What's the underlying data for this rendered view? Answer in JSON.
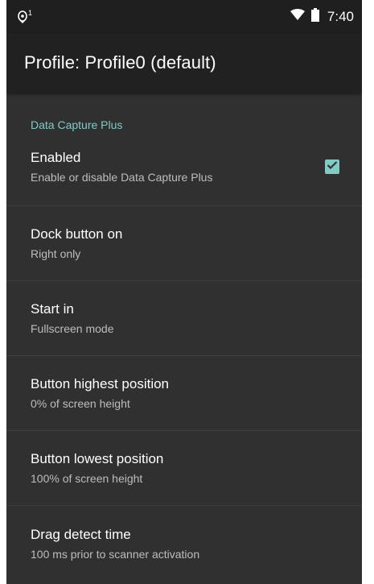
{
  "status_bar": {
    "notification_icon": "location-pin-icon",
    "notification_count": "1",
    "wifi_icon": "wifi-icon",
    "battery_icon": "battery-icon",
    "time": "7:40"
  },
  "app_bar": {
    "title": "Profile: Profile0 (default)"
  },
  "category": {
    "label": "Data Capture Plus"
  },
  "items": [
    {
      "title": "Enabled",
      "summary": "Enable or disable Data Capture Plus",
      "checked": true
    },
    {
      "title": "Dock button on",
      "summary": "Right only"
    },
    {
      "title": "Start in",
      "summary": "Fullscreen mode"
    },
    {
      "title": "Button highest position",
      "summary": "0% of screen height"
    },
    {
      "title": "Button lowest position",
      "summary": "100% of screen height"
    },
    {
      "title": "Drag detect time",
      "summary": "100 ms prior to scanner activation"
    }
  ],
  "colors": {
    "accent": "#80cbc4",
    "background": "#303030",
    "app_bar": "#212121",
    "status_bar": "#1f1f1f"
  }
}
